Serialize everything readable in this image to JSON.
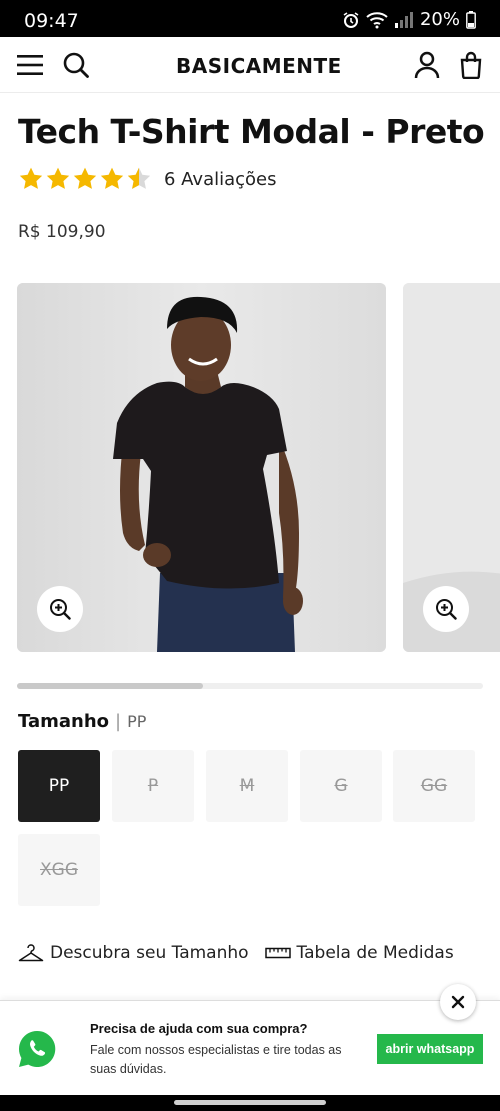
{
  "status": {
    "time": "09:47",
    "battery": "20%"
  },
  "brand": {
    "logo": "BASICAMENTE"
  },
  "product": {
    "title": "Tech T-Shirt Modal - Preto",
    "rating": 4.5,
    "rating_max": 5,
    "reviews": "6 Avaliações",
    "price": "R$ 109,90",
    "color_swatch": "#1e1a1c"
  },
  "gallery": {
    "progress": 0.4
  },
  "sizes": {
    "label": "Tamanho",
    "selected": "PP",
    "options": [
      {
        "label": "PP",
        "available": true,
        "selected": true
      },
      {
        "label": "P",
        "available": false
      },
      {
        "label": "M",
        "available": false
      },
      {
        "label": "G",
        "available": false
      },
      {
        "label": "GG",
        "available": false
      },
      {
        "label": "XGG",
        "available": false
      }
    ]
  },
  "links": {
    "discover_size": "Descubra seu Tamanho",
    "size_chart": "Tabela de Medidas"
  },
  "chat": {
    "title": "Precisa de ajuda com sua compra?",
    "text": "Fale com nossos especialistas e tire todas as suas dúvidas.",
    "button": "abrir whatsapp"
  },
  "colors": {
    "star": "#f5b800",
    "whatsapp": "#25b84b",
    "selected_size_bg": "#1f1f1f"
  },
  "icons": [
    "menu-icon",
    "search-icon",
    "user-icon",
    "bag-icon",
    "zoom-in-icon",
    "hanger-icon",
    "ruler-icon",
    "whatsapp-icon",
    "close-icon",
    "alarm-icon",
    "wifi-icon",
    "signal-icon",
    "battery-icon"
  ]
}
